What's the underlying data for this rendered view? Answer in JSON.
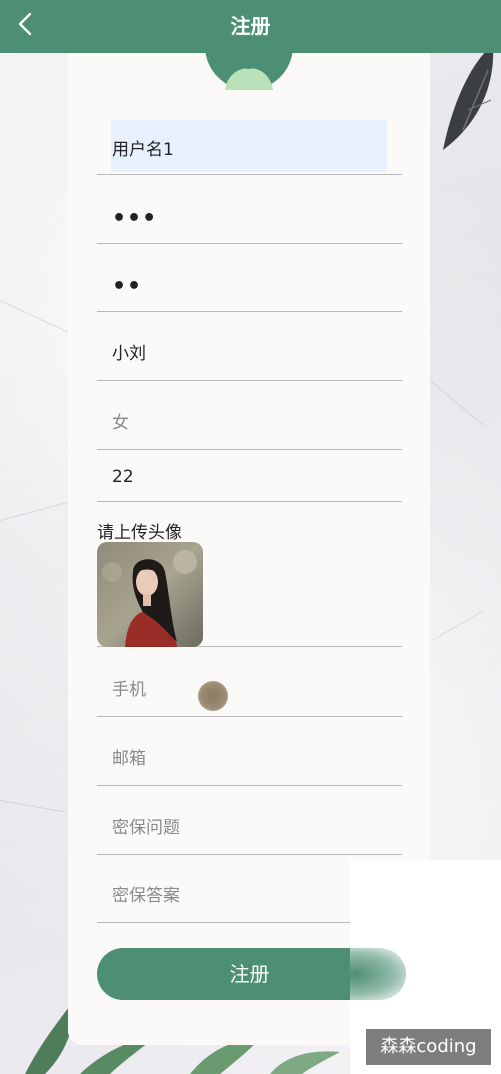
{
  "header": {
    "title": "注册",
    "back_icon": "chevron-left-icon"
  },
  "form": {
    "username": {
      "value": "用户名1"
    },
    "password": {
      "value": "•••"
    },
    "confirm_password": {
      "value": "••"
    },
    "nickname": {
      "value": "小刘"
    },
    "gender": {
      "placeholder": "女"
    },
    "age": {
      "value": "22"
    },
    "avatar_upload": {
      "label": "请上传头像"
    },
    "phone": {
      "placeholder": "手机"
    },
    "email": {
      "placeholder": "邮箱"
    },
    "security_question": {
      "placeholder": "密保问题"
    },
    "security_answer": {
      "placeholder": "密保答案"
    },
    "submit_label": "注册"
  },
  "watermark": "森森coding",
  "colors": {
    "primary": "#4d8f74",
    "avatar_bg": "#4d8f74",
    "avatar_accent": "#b9e2b9"
  }
}
